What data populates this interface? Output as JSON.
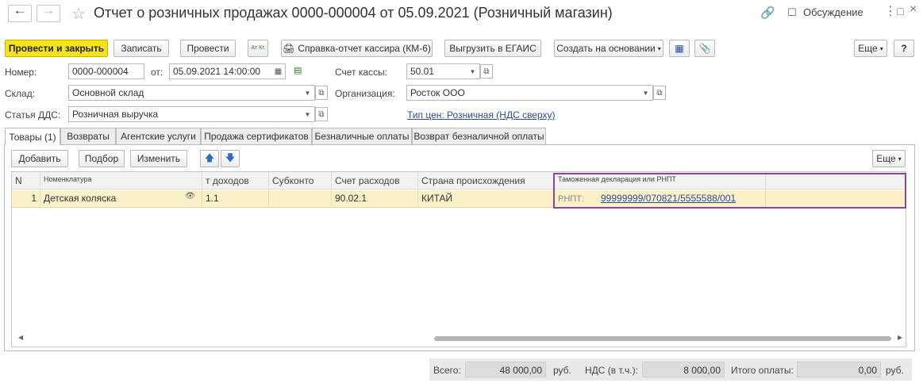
{
  "window": {
    "title": "Отчет о розничных продажах 0000-000004 от 05.09.2021 (Розничный магазин)",
    "discussion_label": "Обсуждение"
  },
  "toolbar": {
    "post_close": "Провести и закрыть",
    "save": "Записать",
    "post": "Провести",
    "dt_kt": "Ат Кт",
    "cashier_report": "Справка-отчет кассира (КМ-6)",
    "egais": "Выгрузить в ЕГАИС",
    "create_based": "Создать на основании",
    "more": "Еще",
    "help": "?"
  },
  "header": {
    "number_label": "Номер:",
    "number_value": "0000-000004",
    "from_label": "от:",
    "date_value": "05.09.2021 14:00:00",
    "cash_account_label": "Счет кассы:",
    "cash_account_value": "50.01",
    "warehouse_label": "Склад:",
    "warehouse_value": "Основной склад",
    "org_label": "Организация:",
    "org_value": "Росток ООО",
    "dds_label": "Статья ДДС:",
    "dds_value": "Розничная выручка",
    "price_type_link": "Тип цен: Розничная (НДС сверху)"
  },
  "tabs": [
    {
      "label": "Товары (1)"
    },
    {
      "label": "Возвраты"
    },
    {
      "label": "Агентские услуги"
    },
    {
      "label": "Продажа сертификатов"
    },
    {
      "label": "Безналичные оплаты"
    },
    {
      "label": "Возврат безналичной оплаты"
    }
  ],
  "table_toolbar": {
    "add": "Добавить",
    "pick": "Подбор",
    "edit": "Изменить",
    "more": "Еще"
  },
  "table": {
    "columns": {
      "n": "N",
      "nomenclature": "Номенклатура",
      "income_account": "т доходов",
      "subconto": "Субконто",
      "expense_account": "Счет расходов",
      "country": "Страна происхождения",
      "customs": "Таможенная декларация или РНПТ"
    },
    "rows": [
      {
        "n": "1",
        "nomenclature": "Детская коляска",
        "income_account": "1.1",
        "subconto": "",
        "expense_account": "90.02.1",
        "country": "КИТАЙ",
        "rnpt_label": "РНПТ:",
        "rnpt_value": "99999999/070821/5555588/001"
      }
    ]
  },
  "footer": {
    "total_label": "Всего:",
    "total_value": "48 000,00",
    "total_currency": "руб.",
    "vat_label": "НДС (в т.ч.):",
    "vat_value": "8 000,00",
    "pay_label": "Итого оплаты:",
    "pay_value": "0,00",
    "pay_currency": "руб."
  }
}
